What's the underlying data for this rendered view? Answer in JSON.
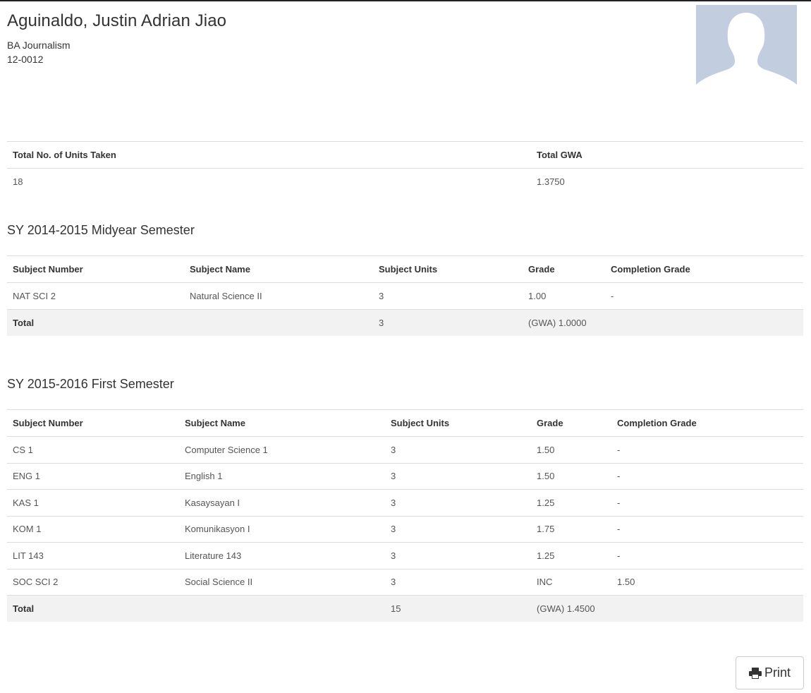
{
  "student": {
    "name": "Aguinaldo, Justin Adrian Jiao",
    "program": "BA Journalism",
    "id": "12-0012"
  },
  "summary": {
    "headers": [
      "Total No. of Units Taken",
      "Total GWA"
    ],
    "values": [
      "18",
      "1.3750"
    ]
  },
  "semesters": [
    {
      "title": "SY 2014-2015 Midyear Semester",
      "headers": [
        "Subject Number",
        "Subject Name",
        "Subject Units",
        "Grade",
        "Completion Grade"
      ],
      "rows": [
        [
          "NAT SCI 2",
          "Natural Science II",
          "3",
          "1.00",
          "-"
        ]
      ],
      "total": {
        "label": "Total",
        "units": "3",
        "gwa": "(GWA) 1.0000"
      }
    },
    {
      "title": "SY 2015-2016 First Semester",
      "headers": [
        "Subject Number",
        "Subject Name",
        "Subject Units",
        "Grade",
        "Completion Grade"
      ],
      "rows": [
        [
          "CS 1",
          "Computer Science 1",
          "3",
          "1.50",
          "-"
        ],
        [
          "ENG 1",
          "English 1",
          "3",
          "1.50",
          "-"
        ],
        [
          "KAS 1",
          "Kasaysayan I",
          "3",
          "1.25",
          "-"
        ],
        [
          "KOM 1",
          "Komunikasyon I",
          "3",
          "1.75",
          "-"
        ],
        [
          "LIT 143",
          "Literature 143",
          "3",
          "1.25",
          "-"
        ],
        [
          "SOC SCI 2",
          "Social Science II",
          "3",
          "INC",
          "1.50"
        ]
      ],
      "total": {
        "label": "Total",
        "units": "15",
        "gwa": "(GWA) 1.4500"
      }
    }
  ],
  "actions": {
    "print_label": "Print"
  },
  "icons": {
    "avatar": "person-silhouette-icon",
    "print": "printer-icon"
  },
  "colors": {
    "avatar_bg": "#c3cde0",
    "total_row_bg": "#f2f2f2",
    "border": "#dddddd"
  }
}
